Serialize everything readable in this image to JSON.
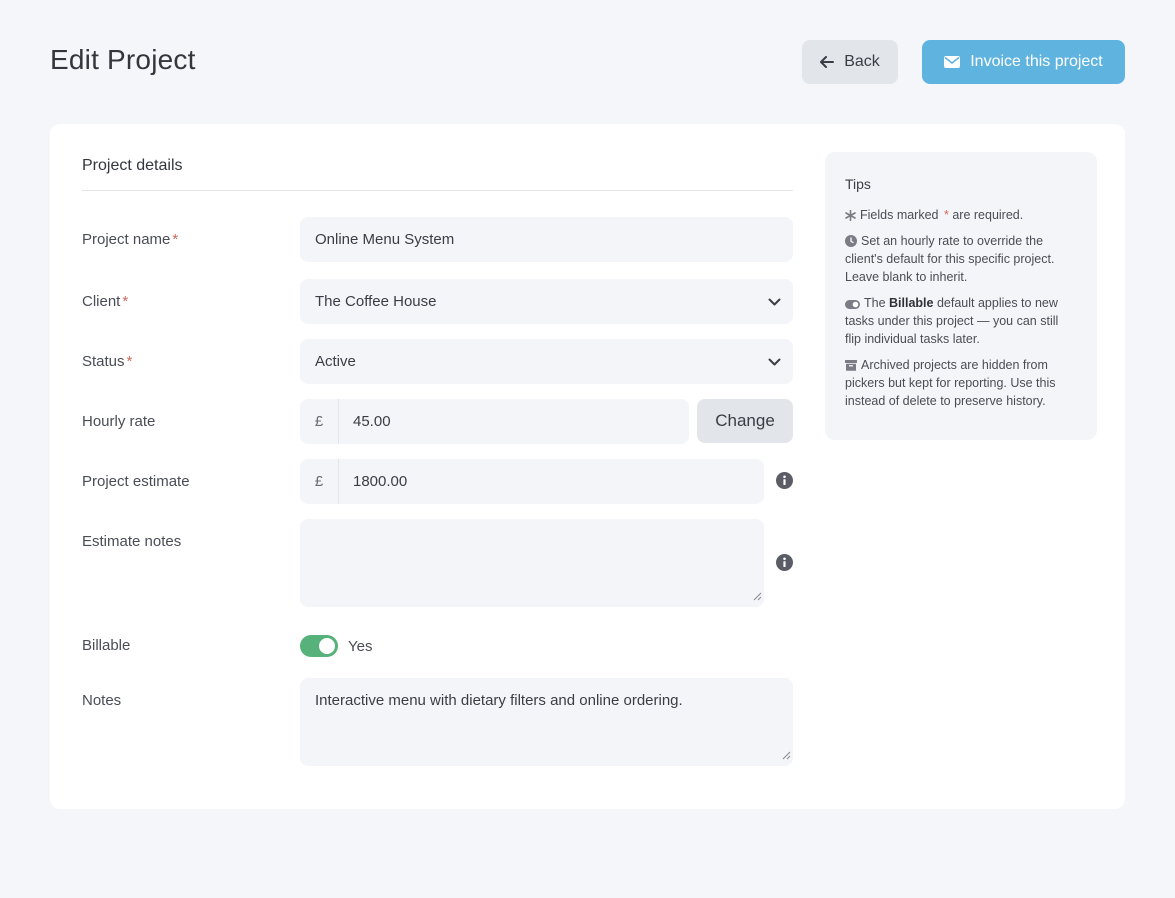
{
  "header": {
    "title": "Edit Project",
    "back_label": "Back",
    "invoice_label": "Invoice this project"
  },
  "form": {
    "section_title": "Project details",
    "required_marker": "*",
    "project_name": {
      "label": "Project name",
      "value": "Online Menu System"
    },
    "client": {
      "label": "Client",
      "value": "The Coffee House"
    },
    "status": {
      "label": "Status",
      "value": "Active"
    },
    "hourly_rate": {
      "label": "Hourly rate",
      "currency": "£",
      "value": "45.00",
      "change_label": "Change"
    },
    "project_estimate": {
      "label": "Project estimate",
      "currency": "£",
      "value": "1800.00"
    },
    "estimate_notes": {
      "label": "Estimate notes",
      "value": ""
    },
    "billable": {
      "label": "Billable",
      "state_label": "Yes",
      "on": true
    },
    "notes": {
      "label": "Notes",
      "value": "Interactive menu with dietary filters and online ordering."
    }
  },
  "tips": {
    "title": "Tips",
    "tip1_pre": "Fields marked ",
    "tip1_star": "*",
    "tip1_post": " are required.",
    "tip2": "Set an hourly rate to override the client's default for this specific project. Leave blank to inherit.",
    "tip3_pre": "The ",
    "tip3_bold": "Billable",
    "tip3_post": " default applies to new tasks under this project — you can still flip individual tasks later.",
    "tip4": "Archived projects are hidden from pickers but kept for reporting. Use this instead of delete to preserve history."
  },
  "colors": {
    "accent": "#5fb4df",
    "toggle_on": "#56b27a",
    "required": "#d0685a",
    "background": "#f5f6fa"
  },
  "icons": {
    "back": "arrow-left-icon",
    "invoice": "envelope-icon",
    "select": "chevron-down-icon",
    "info": "info-circle-icon",
    "tip1": "asterisk-icon",
    "tip2": "clock-icon",
    "tip3": "toggle-icon",
    "tip4": "archive-icon"
  }
}
